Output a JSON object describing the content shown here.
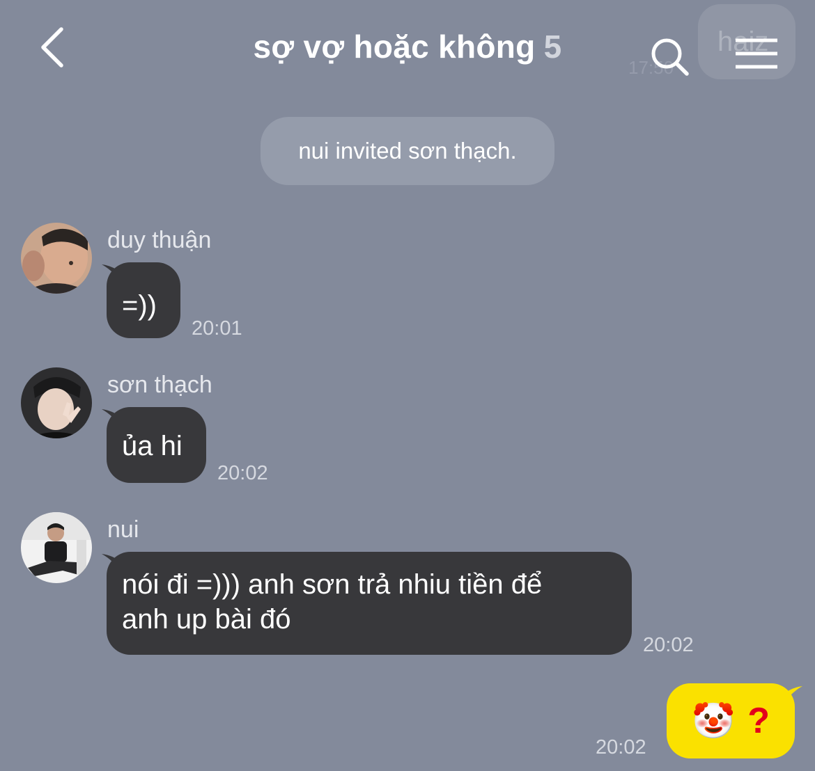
{
  "header": {
    "title": "sợ vợ hoặc không",
    "member_count": "5",
    "back_icon": "chevron-left-icon",
    "search_icon": "search-icon",
    "menu_icon": "hamburger-menu-icon"
  },
  "system_message": "nui invited sơn thạch.",
  "messages": [
    {
      "sender": "duy thuận",
      "text": "=))",
      "time": "20:01"
    },
    {
      "sender": "sơn thạch",
      "text": "ủa hi",
      "time": "20:02"
    },
    {
      "sender": "nui",
      "line1": "nói đi =))) anh sơn trả nhiu tiền để",
      "line2": "anh up bài đó",
      "time": "20:02"
    }
  ],
  "my_message": {
    "emoji": "🤡",
    "question": "?",
    "time": "20:02"
  },
  "colors": {
    "background": "#838a9b",
    "incoming_bubble": "#38383b",
    "outgoing_bubble": "#fae100",
    "system_pill": "#959cab"
  }
}
